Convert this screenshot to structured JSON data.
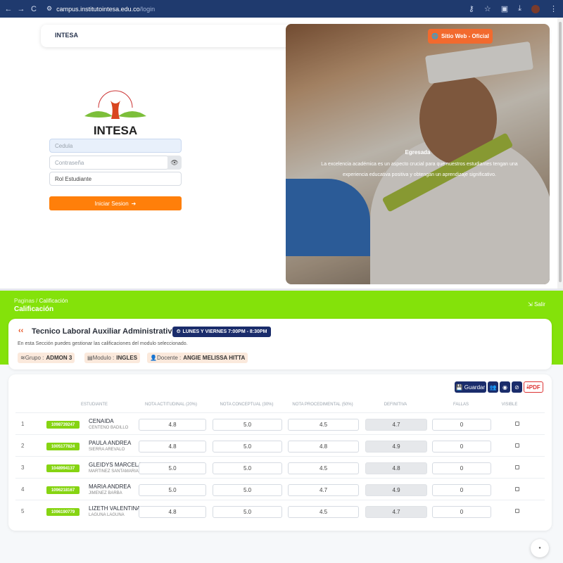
{
  "browser": {
    "back": "←",
    "forward": "→",
    "reload": "C",
    "url_host": "campus.institutointesa.edu.co",
    "url_path": "/login"
  },
  "login": {
    "brand": "INTESA",
    "sitio_button": "Sitio Web - Oficial",
    "logo_text": "INTESA",
    "logo_arc": "INSTITUTO TECNICO DEL SABER",
    "cedula_placeholder": "Cedula",
    "password_placeholder": "Contraseña",
    "role_value": "Rol Estudiante",
    "login_button": "Iniciar Sesion",
    "hero_title": "Egresada",
    "hero_text": "La excelencia académica es un aspecto crucial para que nuestros estudiantes tengan una experiencia educativa positiva y obtengan un aprendizaje significativo.",
    "colors": {
      "accent": "#ff7f0a",
      "sitio": "#f26a2e"
    }
  },
  "header": {
    "crumb_root": "Paginas",
    "crumb_sep": "/",
    "crumb_current": "Calificación",
    "title": "Calificación",
    "logout": "Salir"
  },
  "course": {
    "title": "Tecnico Laboral Auxiliar Administrativo",
    "schedule": "LUNES Y VIERNES 7:00PM - 8:30PM",
    "description": "En esta Sección puedes gestionar las calificaciones del modulo seleccionado.",
    "group_label": "Grupo :",
    "group_value": "ADMON 3",
    "module_label": "Modulo :",
    "module_value": "INGLES",
    "teacher_label": "Docente :",
    "teacher_value": "ANGIE MELISSA HITTA"
  },
  "toolbar": {
    "save": "Guardar",
    "pdf": "PDF"
  },
  "table": {
    "headers": [
      "ESTUDIANTE",
      "NOTA ACTITUDINAL (20%)",
      "NOTA CONCEPTUAL (30%)",
      "NOTA PROCEDIMENTAL (50%)",
      "DEFINITIVA",
      "FALLAS",
      "VISIBLE"
    ],
    "rows": [
      {
        "n": "1",
        "doc": "1098739247",
        "name": "CENAIDA",
        "surname": "CENTENO BADILLO",
        "act": "4.8",
        "con": "5.0",
        "proc": "4.5",
        "def": "4.7",
        "fallas": "0"
      },
      {
        "n": "2",
        "doc": "1005177824",
        "name": "PAULA ANDREA",
        "surname": "SIERRA AREVALO",
        "act": "4.8",
        "con": "5.0",
        "proc": "4.8",
        "def": "4.9",
        "fallas": "0"
      },
      {
        "n": "3",
        "doc": "1048994137",
        "name": "GLEIDYS MARCELA",
        "surname": "MARTINEZ SANTAMARIA",
        "act": "5.0",
        "con": "5.0",
        "proc": "4.5",
        "def": "4.8",
        "fallas": "0"
      },
      {
        "n": "4",
        "doc": "1096218167",
        "name": "MARIA ANDREA",
        "surname": "JIMENEZ BARBA",
        "act": "5.0",
        "con": "5.0",
        "proc": "4.7",
        "def": "4.9",
        "fallas": "0"
      },
      {
        "n": "5",
        "doc": "1096190779",
        "name": "LIZETH VALENTINA",
        "surname": "LAGUNA LAGUNA",
        "act": "4.8",
        "con": "5.0",
        "proc": "4.5",
        "def": "4.7",
        "fallas": "0"
      }
    ]
  }
}
